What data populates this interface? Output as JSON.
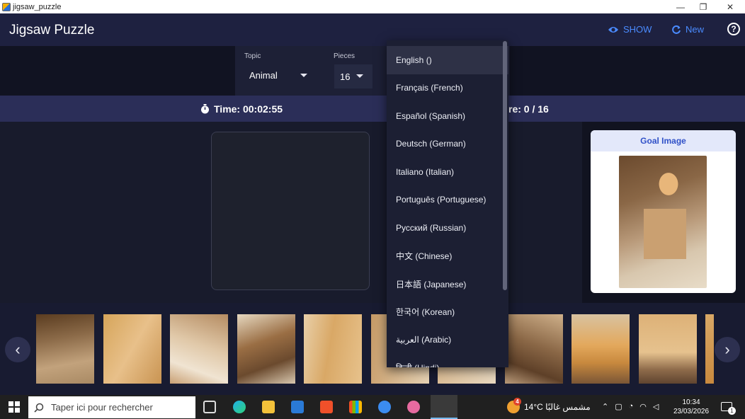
{
  "window": {
    "title": "jigsaw_puzzle",
    "minimize": "—",
    "maximize": "❐",
    "close": "✕"
  },
  "header": {
    "title": "Jigsaw Puzzle",
    "show_label": "SHOW",
    "new_label": "New",
    "help_label": "?",
    "accent_color": "#4a8bff"
  },
  "controls": {
    "topic_label": "Topic",
    "topic_value": "Animal",
    "pieces_label": "Pieces",
    "pieces_value": "16"
  },
  "status": {
    "time_text": "Time: 00:02:55",
    "score_text": "re: 0 / 16"
  },
  "goal": {
    "title": "Goal Image"
  },
  "language_menu": {
    "selected": "English ()",
    "items": [
      "English ()",
      "Français (French)",
      "Español (Spanish)",
      "Deutsch (German)",
      "Italiano (Italian)",
      "Português (Portuguese)",
      "Русский (Russian)",
      "中文 (Chinese)",
      "日本語 (Japanese)",
      "한국어 (Korean)",
      "العربية (Arabic)",
      "हिन्दी (Hindi)"
    ]
  },
  "tray": {
    "prev_icon": "chevron-left-icon",
    "next_icon": "chevron-right-icon"
  },
  "taskbar": {
    "search_placeholder": "Taper ici pour rechercher",
    "weather": "14°C  مشمس غالبًا",
    "weather_badge": "4",
    "time": "10:34",
    "date": "23/03/2026",
    "notification_count": "1"
  }
}
